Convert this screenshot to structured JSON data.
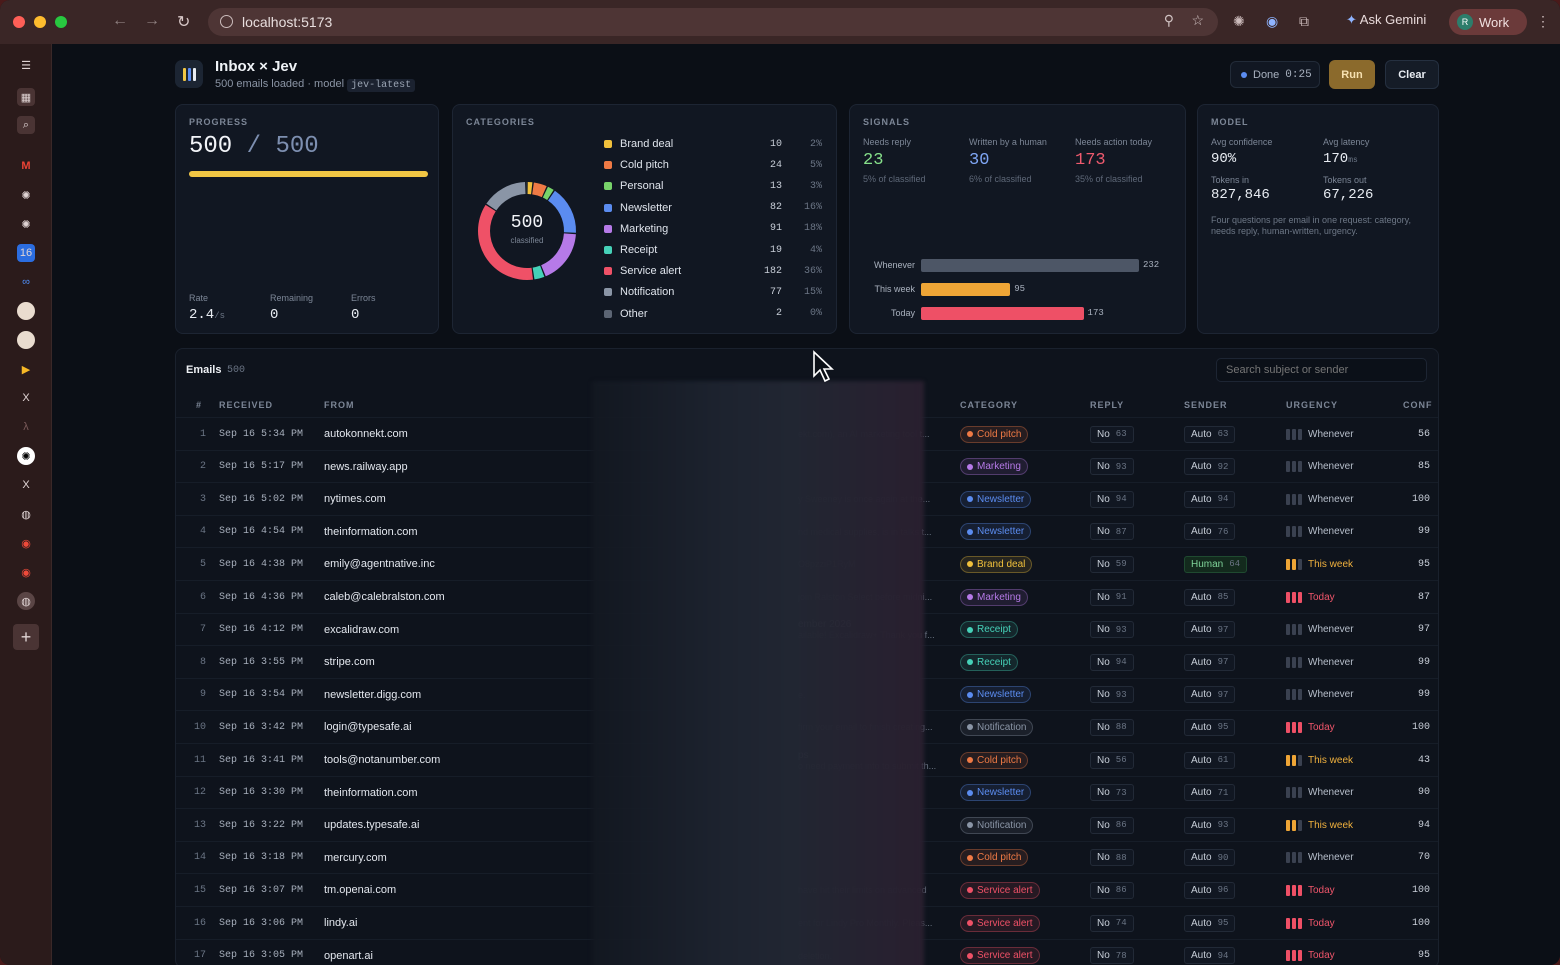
{
  "browser": {
    "url": "localhost:5173",
    "ask_gemini": "Ask Gemini",
    "profile": "Work",
    "profile_initial": "R"
  },
  "header": {
    "title": "Inbox × Jev",
    "subtitle_prefix": "500 emails loaded · model",
    "model_code": "jev-latest",
    "status_label": "Done",
    "status_time": "0:25",
    "run_label": "Run",
    "clear_label": "Clear"
  },
  "progress": {
    "label": "PROGRESS",
    "done": "500",
    "total": "500",
    "fraction": 1.0,
    "rate_label": "Rate",
    "rate_value": "2.4",
    "rate_unit": "/s",
    "remaining_label": "Remaining",
    "remaining_value": "0",
    "errors_label": "Errors",
    "errors_value": "0"
  },
  "categories": {
    "label": "CATEGORIES",
    "total": "500",
    "total_label": "classified",
    "items": [
      {
        "name": "Brand deal",
        "count": "10",
        "pct": "2%",
        "color": "#f0c03c"
      },
      {
        "name": "Cold pitch",
        "count": "24",
        "pct": "5%",
        "color": "#ef7a45"
      },
      {
        "name": "Personal",
        "count": "13",
        "pct": "3%",
        "color": "#78d36a"
      },
      {
        "name": "Newsletter",
        "count": "82",
        "pct": "16%",
        "color": "#5b8cf0"
      },
      {
        "name": "Marketing",
        "count": "91",
        "pct": "18%",
        "color": "#b67ae8"
      },
      {
        "name": "Receipt",
        "count": "19",
        "pct": "4%",
        "color": "#46d1b8"
      },
      {
        "name": "Service alert",
        "count": "182",
        "pct": "36%",
        "color": "#ef5167"
      },
      {
        "name": "Notification",
        "count": "77",
        "pct": "15%",
        "color": "#8a95a6"
      },
      {
        "name": "Other",
        "count": "2",
        "pct": "0%",
        "color": "#5c6574"
      }
    ]
  },
  "signals": {
    "label": "SIGNALS",
    "needs_reply_label": "Needs reply",
    "needs_reply_value": "23",
    "needs_reply_sub": "5% of classified",
    "human_label": "Written by a human",
    "human_value": "30",
    "human_sub": "6% of classified",
    "action_label": "Needs action today",
    "action_value": "173",
    "action_sub": "35% of classified",
    "urgency": [
      {
        "label": "Whenever",
        "value": 232,
        "color": "#4d5666"
      },
      {
        "label": "This week",
        "value": 95,
        "color": "#eea536"
      },
      {
        "label": "Today",
        "value": 173,
        "color": "#ee5066"
      }
    ]
  },
  "model": {
    "label": "MODEL",
    "confidence_label": "Avg confidence",
    "confidence_value": "90%",
    "latency_label": "Avg latency",
    "latency_value": "170",
    "latency_unit": "ms",
    "tokens_in_label": "Tokens in",
    "tokens_in_value": "827,846",
    "tokens_out_label": "Tokens out",
    "tokens_out_value": "67,226",
    "note": "Four questions per email in one request: category, needs reply, human-written, urgency."
  },
  "emails": {
    "title": "Emails",
    "count": "500",
    "search_placeholder": "Search subject or sender",
    "columns": {
      "num": "#",
      "received": "RECEIVED",
      "from": "FROM",
      "category": "CATEGORY",
      "reply": "REPLY",
      "sender": "SENDER",
      "urgency": "URGENCY",
      "conf": "CONF"
    },
    "rows": [
      {
        "n": "1",
        "time": "Sep 16  5:34 PM",
        "from": "autokonnekt.com",
        "snip": "ekt.com), an AI marketing tool t...",
        "snip2": "",
        "cat": "Cold pitch",
        "reply": "No",
        "reply_n": "63",
        "sender": "Auto",
        "sender_n": "63",
        "urg": "Whenever",
        "conf": "56"
      },
      {
        "n": "2",
        "time": "Sep 16  5:17 PM",
        "from": "news.railway.app",
        "snip": "",
        "snip2": "",
        "cat": "Marketing",
        "reply": "No",
        "reply_n": "93",
        "sender": "Auto",
        "sender_n": "92",
        "urg": "Whenever",
        "conf": "85"
      },
      {
        "n": "3",
        "time": "Sep 16  5:02 PM",
        "from": "nytimes.com",
        "snip": "y Sweeney is once again at the...",
        "snip2": "",
        "cat": "Newsletter",
        "reply": "No",
        "reply_n": "94",
        "sender": "Auto",
        "sender_n": "94",
        "urg": "Whenever",
        "conf": "100"
      },
      {
        "n": "4",
        "time": "Sep 16  4:54 PM",
        "from": "theinformation.com",
        "snip": "nd medical supplies, is in talks t...",
        "snip2": "",
        "cat": "Newsletter",
        "reply": "No",
        "reply_n": "87",
        "sender": "Auto",
        "sender_n": "76",
        "urg": "Whenever",
        "conf": "99"
      },
      {
        "n": "5",
        "time": "Sep 16  4:38 PM",
        "from": "emily@agentnative.inc",
        "snip": "O8pzziP1RyM",
        "snip2": "",
        "cat": "Brand deal",
        "reply": "No",
        "reply_n": "59",
        "sender": "Human",
        "sender_n": "64",
        "urg": "This week",
        "conf": "95"
      },
      {
        "n": "6",
        "time": "Sep 16  4:36 PM",
        "from": "caleb@calebralston.com",
        "snip": "join Ralston Select before midni...",
        "snip2": "",
        "cat": "Marketing",
        "reply": "No",
        "reply_n": "91",
        "sender": "Auto",
        "sender_n": "85",
        "urg": "Today",
        "conf": "87"
      },
      {
        "n": "7",
        "time": "Sep 16  4:12 PM",
        "from": "excalidraw.com",
        "snip": "ailable! Excalidraw+ Thank you f...",
        "snip2": "ember 2026",
        "cat": "Receipt",
        "reply": "No",
        "reply_n": "93",
        "sender": "Auto",
        "sender_n": "97",
        "urg": "Whenever",
        "conf": "97"
      },
      {
        "n": "8",
        "time": "Sep 16  3:55 PM",
        "from": "stripe.com",
        "snip": "",
        "snip2": "",
        "cat": "Receipt",
        "reply": "No",
        "reply_n": "94",
        "sender": "Auto",
        "sender_n": "97",
        "urg": "Whenever",
        "conf": "99"
      },
      {
        "n": "9",
        "time": "Sep 16  3:54 PM",
        "from": "newsletter.digg.com",
        "snip": "e.",
        "snip2": "",
        "cat": "Newsletter",
        "reply": "No",
        "reply_n": "93",
        "sender": "Auto",
        "sender_n": "97",
        "urg": "Whenever",
        "conf": "99"
      },
      {
        "n": "10",
        "time": "Sep 16  3:42 PM",
        "from": "login@typesafe.ai",
        "snip": "firm your email to finish creating...",
        "snip2": "",
        "cat": "Notification",
        "reply": "No",
        "reply_n": "88",
        "sender": "Auto",
        "sender_n": "95",
        "urg": "Today",
        "conf": "100"
      },
      {
        "n": "11",
        "time": "Sep 16  3:41 PM",
        "from": "tools@notanumber.com",
        "snip": "o need payment info to submit th...",
        "snip2": "ps",
        "cat": "Cold pitch",
        "reply": "No",
        "reply_n": "56",
        "sender": "Auto",
        "sender_n": "61",
        "urg": "This week",
        "conf": "43"
      },
      {
        "n": "12",
        "time": "Sep 16  3:30 PM",
        "from": "theinformation.com",
        "snip": "",
        "snip2": "",
        "cat": "Newsletter",
        "reply": "No",
        "reply_n": "73",
        "sender": "Auto",
        "sender_n": "71",
        "urg": "Whenever",
        "conf": "90"
      },
      {
        "n": "13",
        "time": "Sep 16  3:22 PM",
        "from": "updates.typesafe.ai",
        "snip": "",
        "snip2": "",
        "cat": "Notification",
        "reply": "No",
        "reply_n": "86",
        "sender": "Auto",
        "sender_n": "93",
        "urg": "This week",
        "conf": "94"
      },
      {
        "n": "14",
        "time": "Sep 16  3:18 PM",
        "from": "mercury.com",
        "snip": "",
        "snip2": "",
        "cat": "Cold pitch",
        "reply": "No",
        "reply_n": "88",
        "sender": "Auto",
        "sender_n": "90",
        "urg": "Whenever",
        "conf": "70"
      },
      {
        "n": "15",
        "time": "Sep 16  3:07 PM",
        "from": "tm.openai.com",
        "snip": "have hit their limits on advanced",
        "snip2": "",
        "cat": "Service alert",
        "reply": "No",
        "reply_n": "86",
        "sender": "Auto",
        "sender_n": "96",
        "urg": "Today",
        "conf": "100"
      },
      {
        "n": "16",
        "time": "Sep 16  3:06 PM",
        "from": "lindy.ai",
        "snip": "ent for Lindy Pro Monthly. Pleas...",
        "snip2": "",
        "cat": "Service alert",
        "reply": "No",
        "reply_n": "74",
        "sender": "Auto",
        "sender_n": "95",
        "urg": "Today",
        "conf": "100"
      },
      {
        "n": "17",
        "time": "Sep 16  3:05 PM",
        "from": "openart.ai",
        "snip": "deletion.",
        "snip2": "",
        "cat": "Service alert",
        "reply": "No",
        "reply_n": "78",
        "sender": "Auto",
        "sender_n": "94",
        "urg": "Today",
        "conf": "95"
      }
    ]
  }
}
